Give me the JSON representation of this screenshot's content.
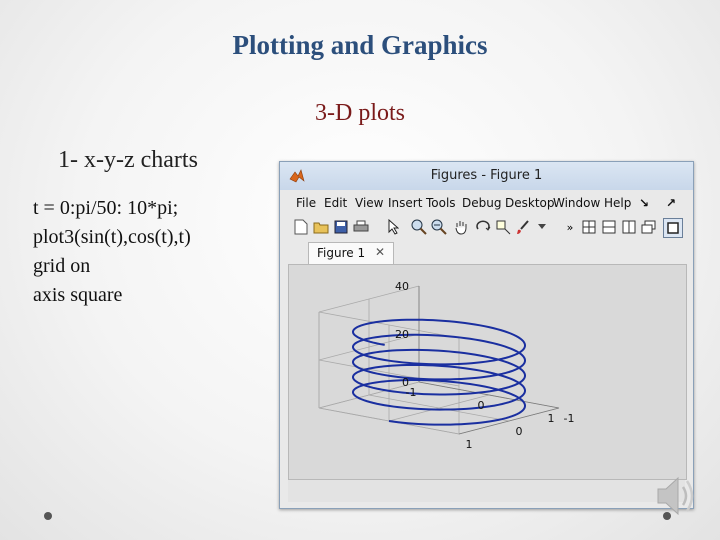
{
  "slide": {
    "title": "Plotting and Graphics",
    "subtitle": "3-D plots",
    "heading": "1- x-y-z charts",
    "code_lines": [
      "t = 0:pi/50: 10*pi;",
      "plot3(sin(t),cos(t),t)",
      "grid on",
      "axis square"
    ]
  },
  "window": {
    "title": "Figures - Figure 1",
    "menus": [
      "File",
      "Edit",
      "View",
      "Insert",
      "Tools",
      "Debug",
      "Desktop",
      "Window",
      "Help"
    ],
    "tab_label": "Figure 1",
    "tab_close": "✕"
  },
  "chart_data": {
    "type": "line",
    "mode": "3d",
    "title": "",
    "series": [
      {
        "x_expr": "sin(t)",
        "y_expr": "cos(t)",
        "z_expr": "t",
        "t_start": 0,
        "t_end": 31.4159,
        "t_step": 0.062832
      }
    ],
    "xlim": [
      -1,
      1
    ],
    "ylim": [
      -1,
      1
    ],
    "zlim": [
      0,
      40
    ],
    "x_ticks": [
      "-1",
      "0",
      "1"
    ],
    "y_ticks": [
      "-1",
      "0",
      "1"
    ],
    "z_ticks": [
      "0",
      "20",
      "40"
    ],
    "grid": true,
    "axis_square": true,
    "line_color": "#1a2fa0"
  },
  "colors": {
    "title": "#2c4f7c",
    "subtitle": "#7a1a1a"
  }
}
